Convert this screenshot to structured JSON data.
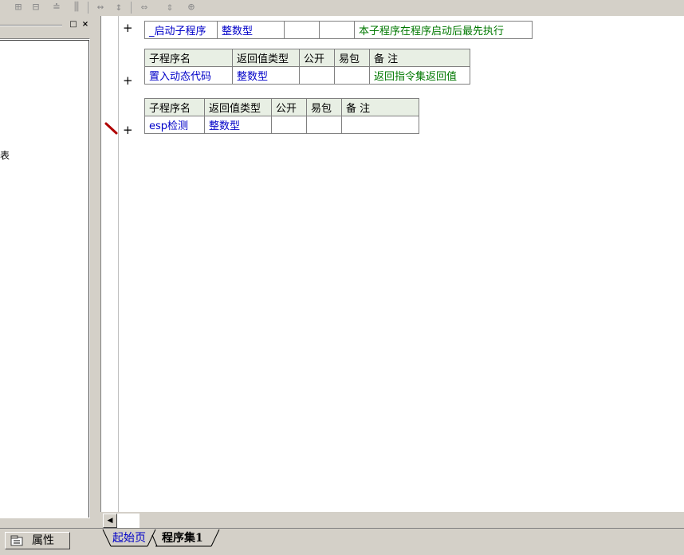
{
  "toolbar": {
    "icons": [
      "split-h-icon",
      "split-v-icon",
      "align-center-icon",
      "align-columns-icon",
      "h-spacing-icon",
      "v-spacing-icon",
      "width-fit-icon",
      "height-fit-icon",
      "grid-fit-icon"
    ]
  },
  "left_pane": {
    "fragment_text": "表",
    "window_buttons": [
      "□",
      "×"
    ]
  },
  "editor": {
    "row1": {
      "name": "_启动子程序",
      "type": "整数型",
      "public": "",
      "easy": "",
      "note": "本子程序在程序启动后最先执行"
    },
    "table2": {
      "headers": [
        "子程序名",
        "返回值类型",
        "公开",
        "易包",
        "备 注"
      ],
      "row": {
        "name": "置入动态代码",
        "type": "整数型",
        "public": "",
        "easy": "",
        "note": "返回指令集返回值"
      }
    },
    "table3": {
      "headers": [
        "子程序名",
        "返回值类型",
        "公开",
        "易包",
        "备 注"
      ],
      "row": {
        "name": "esp检测",
        "type": "整数型",
        "public": "",
        "easy": "",
        "note": ""
      }
    },
    "plus": "+"
  },
  "bottom": {
    "properties_tab": "属性",
    "tabs": [
      "起始页",
      "程序集1"
    ]
  }
}
